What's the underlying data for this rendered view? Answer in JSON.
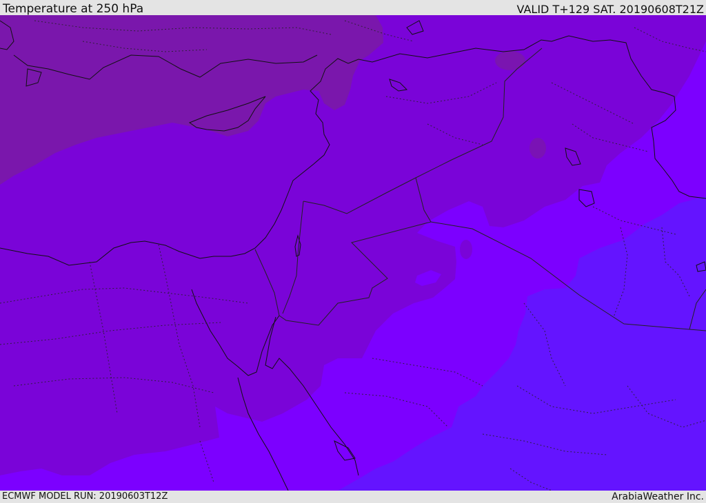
{
  "header": {
    "title": "Temperature at 250 hPa",
    "valid": "VALID T+129 SAT. 20190608T21Z"
  },
  "footer": {
    "model_run": "ECMWF MODEL RUN: 20190603T12Z",
    "credit": "ArabiaWeather Inc."
  },
  "colors": {
    "zone_darkest": "#7a17ac",
    "zone_dark": "#7a04d8",
    "zone_mid": "#7c00ff",
    "zone_blue": "#6414ff",
    "coast_line": "#111111",
    "border_line": "#222222"
  }
}
